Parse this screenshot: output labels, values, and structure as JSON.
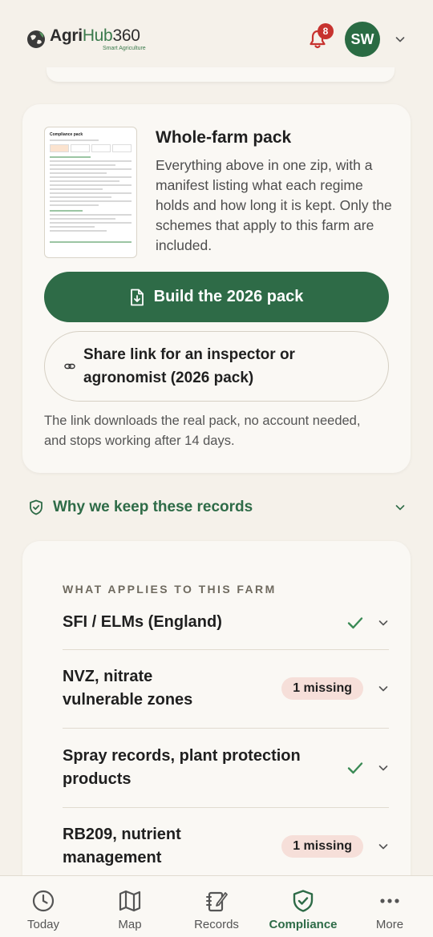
{
  "header": {
    "logo_agri": "Agri",
    "logo_hub": "Hub",
    "logo_num": "360",
    "logo_tagline": "Smart Agriculture",
    "notification_count": "8",
    "avatar_initials": "SW"
  },
  "pack": {
    "thumbnail_title": "Compliance pack",
    "title": "Whole-farm pack",
    "description": "Everything above in one zip, with a manifest listing what each regime holds and how long it is kept. Only the schemes that apply to this farm are included.",
    "build_button": "Build the 2026 pack",
    "share_button": "Share link for an inspector or agronomist (2026 pack)",
    "share_note": "The link downloads the real pack, no account needed, and stops working after 14 days."
  },
  "why": {
    "label": "Why we keep these records"
  },
  "applies": {
    "section_label": "WHAT APPLIES TO THIS FARM",
    "items": [
      {
        "label": "SFI / ELMs (England)",
        "status": "ok"
      },
      {
        "label": "NVZ, nitrate vulnerable zones",
        "status": "missing",
        "badge": "1 missing"
      },
      {
        "label": "Spray records, plant protection products",
        "status": "ok"
      },
      {
        "label": "RB209, nutrient management",
        "status": "missing",
        "badge": "1 missing"
      }
    ]
  },
  "nav": {
    "items": [
      {
        "label": "Today",
        "icon": "clock-icon"
      },
      {
        "label": "Map",
        "icon": "map-icon"
      },
      {
        "label": "Records",
        "icon": "notebook-icon"
      },
      {
        "label": "Compliance",
        "icon": "shield-check-icon",
        "active": true
      },
      {
        "label": "More",
        "icon": "more-dots-icon"
      }
    ]
  },
  "colors": {
    "brand_green": "#2e6b47",
    "badge_red": "#c7332f",
    "missing_bg": "#f6dfd9",
    "check_green": "#3a8a55"
  }
}
